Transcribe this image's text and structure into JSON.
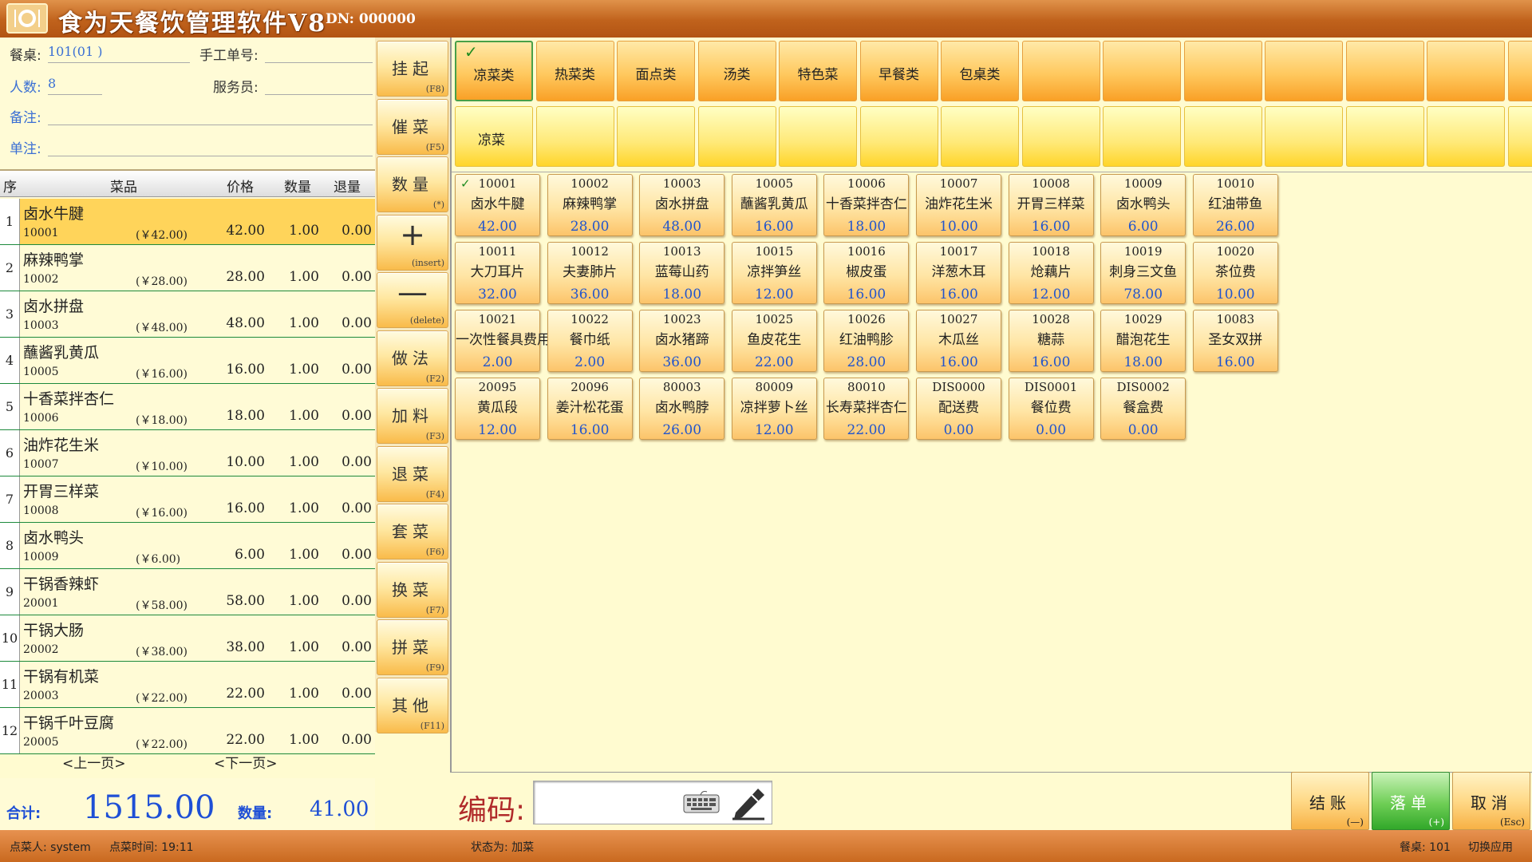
{
  "app": {
    "title": "食为天餐饮管理软件V8",
    "dn": "DN: 000000"
  },
  "info": {
    "table_label": "餐桌:",
    "table_value": "101(01  )",
    "manual_no_label": "手工单号:",
    "guests_label": "人数:",
    "guests_value": "8",
    "waiter_label": "服务员:",
    "remark_label": "备注:",
    "order_note_label": "单注:"
  },
  "order_table": {
    "headers": [
      "序",
      "菜品",
      "价格",
      "数量",
      "退量"
    ],
    "rows": [
      {
        "idx": "1",
        "name": "卤水牛腱",
        "code": "10001",
        "unit": "(￥42.00)",
        "price": "42.00",
        "qty": "1.00",
        "ret": "0.00"
      },
      {
        "idx": "2",
        "name": "麻辣鸭掌",
        "code": "10002",
        "unit": "(￥28.00)",
        "price": "28.00",
        "qty": "1.00",
        "ret": "0.00"
      },
      {
        "idx": "3",
        "name": "卤水拼盘",
        "code": "10003",
        "unit": "(￥48.00)",
        "price": "48.00",
        "qty": "1.00",
        "ret": "0.00"
      },
      {
        "idx": "4",
        "name": "蘸酱乳黄瓜",
        "code": "10005",
        "unit": "(￥16.00)",
        "price": "16.00",
        "qty": "1.00",
        "ret": "0.00"
      },
      {
        "idx": "5",
        "name": "十香菜拌杏仁",
        "code": "10006",
        "unit": "(￥18.00)",
        "price": "18.00",
        "qty": "1.00",
        "ret": "0.00"
      },
      {
        "idx": "6",
        "name": "油炸花生米",
        "code": "10007",
        "unit": "(￥10.00)",
        "price": "10.00",
        "qty": "1.00",
        "ret": "0.00"
      },
      {
        "idx": "7",
        "name": "开胃三样菜",
        "code": "10008",
        "unit": "(￥16.00)",
        "price": "16.00",
        "qty": "1.00",
        "ret": "0.00"
      },
      {
        "idx": "8",
        "name": "卤水鸭头",
        "code": "10009",
        "unit": "(￥6.00)",
        "price": "6.00",
        "qty": "1.00",
        "ret": "0.00"
      },
      {
        "idx": "9",
        "name": "干锅香辣虾",
        "code": "20001",
        "unit": "(￥58.00)",
        "price": "58.00",
        "qty": "1.00",
        "ret": "0.00"
      },
      {
        "idx": "10",
        "name": "干锅大肠",
        "code": "20002",
        "unit": "(￥38.00)",
        "price": "38.00",
        "qty": "1.00",
        "ret": "0.00"
      },
      {
        "idx": "11",
        "name": "干锅有机菜",
        "code": "20003",
        "unit": "(￥22.00)",
        "price": "22.00",
        "qty": "1.00",
        "ret": "0.00"
      },
      {
        "idx": "12",
        "name": "干锅千叶豆腐",
        "code": "20005",
        "unit": "(￥22.00)",
        "price": "22.00",
        "qty": "1.00",
        "ret": "0.00"
      }
    ],
    "prev_page": "<上一页>",
    "next_page": "<下一页>"
  },
  "totals": {
    "sum_label": "合计:",
    "sum_value": "1515.00",
    "qty_label": "数量:",
    "qty_value": "41.00"
  },
  "commands": [
    {
      "label": "挂起",
      "key": "(F8)"
    },
    {
      "label": "催菜",
      "key": "(F5)"
    },
    {
      "label": "数量",
      "key": "(*)"
    },
    {
      "label": "+",
      "key": "(insert)"
    },
    {
      "label": "—",
      "key": "(delete)"
    },
    {
      "label": "做法",
      "key": "(F2)"
    },
    {
      "label": "加料",
      "key": "(F3)"
    },
    {
      "label": "退菜",
      "key": "(F4)"
    },
    {
      "label": "套菜",
      "key": "(F6)"
    },
    {
      "label": "换菜",
      "key": "(F7)"
    },
    {
      "label": "拼菜",
      "key": "(F9)"
    },
    {
      "label": "其他",
      "key": "(F11)"
    }
  ],
  "categories": [
    "凉菜类",
    "热菜类",
    "面点类",
    "汤类",
    "特色菜",
    "早餐类",
    "包桌类",
    "",
    "",
    "",
    "",
    "",
    "",
    ""
  ],
  "subcategories": [
    "凉菜",
    "",
    "",
    "",
    "",
    "",
    "",
    "",
    "",
    "",
    "",
    "",
    "",
    ""
  ],
  "dishes": [
    {
      "code": "10001",
      "name": "卤水牛腱",
      "price": "42.00"
    },
    {
      "code": "10002",
      "name": "麻辣鸭掌",
      "price": "28.00"
    },
    {
      "code": "10003",
      "name": "卤水拼盘",
      "price": "48.00"
    },
    {
      "code": "10005",
      "name": "蘸酱乳黄瓜",
      "price": "16.00"
    },
    {
      "code": "10006",
      "name": "十香菜拌杏仁",
      "price": "18.00"
    },
    {
      "code": "10007",
      "name": "油炸花生米",
      "price": "10.00"
    },
    {
      "code": "10008",
      "name": "开胃三样菜",
      "price": "16.00"
    },
    {
      "code": "10009",
      "name": "卤水鸭头",
      "price": "6.00"
    },
    {
      "code": "10010",
      "name": "红油带鱼",
      "price": "26.00"
    },
    {
      "code": "10011",
      "name": "大刀耳片",
      "price": "32.00"
    },
    {
      "code": "10012",
      "name": "夫妻肺片",
      "price": "36.00"
    },
    {
      "code": "10013",
      "name": "蓝莓山药",
      "price": "18.00"
    },
    {
      "code": "10015",
      "name": "凉拌笋丝",
      "price": "12.00"
    },
    {
      "code": "10016",
      "name": "椒皮蛋",
      "price": "16.00"
    },
    {
      "code": "10017",
      "name": "洋葱木耳",
      "price": "16.00"
    },
    {
      "code": "10018",
      "name": "炝藕片",
      "price": "12.00"
    },
    {
      "code": "10019",
      "name": "刺身三文鱼",
      "price": "78.00"
    },
    {
      "code": "10020",
      "name": "茶位费",
      "price": "10.00"
    },
    {
      "code": "10021",
      "name": "一次性餐具费用",
      "price": "2.00"
    },
    {
      "code": "10022",
      "name": "餐巾纸",
      "price": "2.00"
    },
    {
      "code": "10023",
      "name": "卤水猪蹄",
      "price": "36.00"
    },
    {
      "code": "10025",
      "name": "鱼皮花生",
      "price": "22.00"
    },
    {
      "code": "10026",
      "name": "红油鸭胗",
      "price": "28.00"
    },
    {
      "code": "10027",
      "name": "木瓜丝",
      "price": "16.00"
    },
    {
      "code": "10028",
      "name": "糖蒜",
      "price": "16.00"
    },
    {
      "code": "10029",
      "name": "醋泡花生",
      "price": "18.00"
    },
    {
      "code": "10083",
      "name": "圣女双拼",
      "price": "16.00"
    },
    {
      "code": "20095",
      "name": "黄瓜段",
      "price": "12.00"
    },
    {
      "code": "20096",
      "name": "姜汁松花蛋",
      "price": "16.00"
    },
    {
      "code": "80003",
      "name": "卤水鸭脖",
      "price": "26.00"
    },
    {
      "code": "80009",
      "name": "凉拌萝卜丝",
      "price": "12.00"
    },
    {
      "code": "80010",
      "name": "长寿菜拌杏仁",
      "price": "22.00"
    },
    {
      "code": "DIS0000",
      "name": "配送费",
      "price": "0.00"
    },
    {
      "code": "DIS0001",
      "name": "餐位费",
      "price": "0.00"
    },
    {
      "code": "DIS0002",
      "name": "餐盒费",
      "price": "0.00"
    }
  ],
  "code_entry": {
    "label": "编码:",
    "value": ""
  },
  "actions": [
    {
      "label": "结账",
      "key": "(—)"
    },
    {
      "label": "落单",
      "key": "(+)"
    },
    {
      "label": "取消",
      "key": "(Esc)"
    }
  ],
  "status": {
    "orderer": "点菜人: system",
    "order_time": "点菜时间: 19:11",
    "state": "状态为: 加菜",
    "table": "餐桌: 101",
    "switch": "切换应用"
  },
  "icons": {
    "logo": "plate-cutlery-icon",
    "checkmark": "check-icon",
    "keyboard": "keyboard-icon",
    "pen": "pen-icon"
  }
}
